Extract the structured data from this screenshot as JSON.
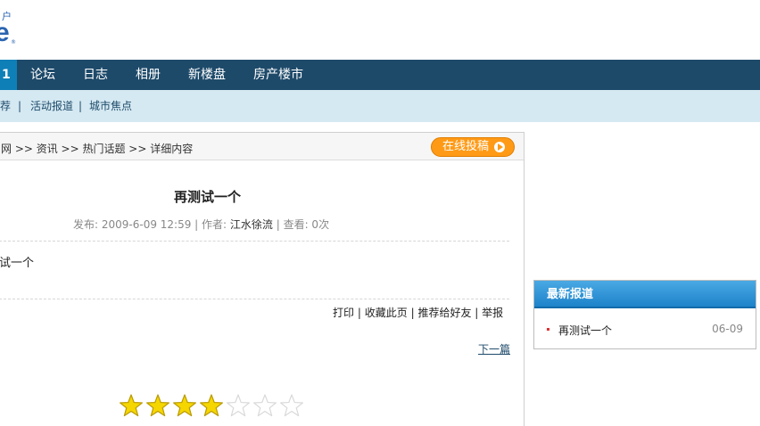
{
  "logo": {
    "top_text": "户",
    "mark": "e",
    "reg": "®"
  },
  "nav": {
    "active_fragment": "1",
    "items": [
      "论坛",
      "日志",
      "相册",
      "新楼盘",
      "房产楼市"
    ]
  },
  "subnav": {
    "items": [
      "荐",
      "活动报道",
      "城市焦点"
    ],
    "separator": "|"
  },
  "breadcrumb": "网 >> 资讯 >> 热门话题 >> 详细内容",
  "submit_button": "在线投稿",
  "article": {
    "title": "再测试一个",
    "meta_prefix": "发布: 2009-6-09 12:59 | 作者: ",
    "author": "江水徐流",
    "meta_suffix": " | 查看: 0次",
    "body": "试一个"
  },
  "tools": [
    "打印",
    "收藏此页",
    "推荐给好友",
    "举报"
  ],
  "tool_separator": "|",
  "next_link": "下一篇",
  "rating": {
    "value": 4,
    "max": 7
  },
  "sidebar": {
    "title": "最新报道",
    "items": [
      {
        "label": "再测试一个",
        "date": "06-09"
      }
    ]
  },
  "colors": {
    "nav_bg": "#1e4a6a",
    "nav_active": "#0f7fb7",
    "subnav_bg": "#d5e9f2",
    "submit_orange": "#ff9a16",
    "side_header_blue": "#1a80c8",
    "star_fill": "#f5d600"
  }
}
